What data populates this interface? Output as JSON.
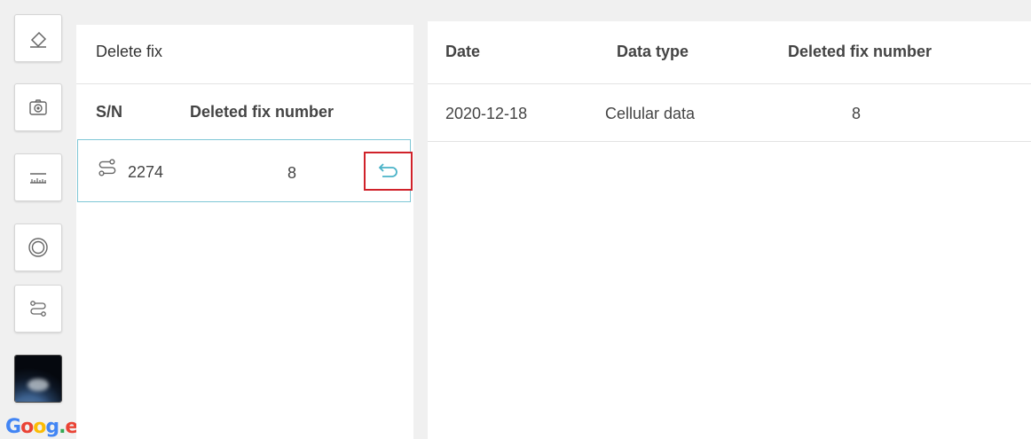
{
  "toolbar": {
    "tools": [
      {
        "icon": "eraser-icon"
      },
      {
        "icon": "camera-icon"
      },
      {
        "icon": "ruler-icon"
      },
      {
        "icon": "target-rings-icon"
      },
      {
        "icon": "route-icon"
      },
      {
        "icon": "earth-layer-thumbnail"
      }
    ]
  },
  "google_logo": {
    "text": "Goog.e"
  },
  "left_panel": {
    "title": "Delete fix",
    "columns": {
      "sn": "S/N",
      "deleted": "Deleted fix number"
    },
    "rows": [
      {
        "icon": "route-icon",
        "sn": "2274",
        "deleted": "8",
        "action_icon": "undo-icon"
      }
    ]
  },
  "right_panel": {
    "columns": {
      "date": "Date",
      "type": "Data type",
      "deleted": "Deleted fix number"
    },
    "rows": [
      {
        "date": "2020-12-18",
        "type": "Cellular data",
        "deleted": "8"
      }
    ]
  },
  "colors": {
    "accent": "#4ab3c8",
    "highlight_border": "#d0222a",
    "row_border": "#7fc7d6"
  }
}
